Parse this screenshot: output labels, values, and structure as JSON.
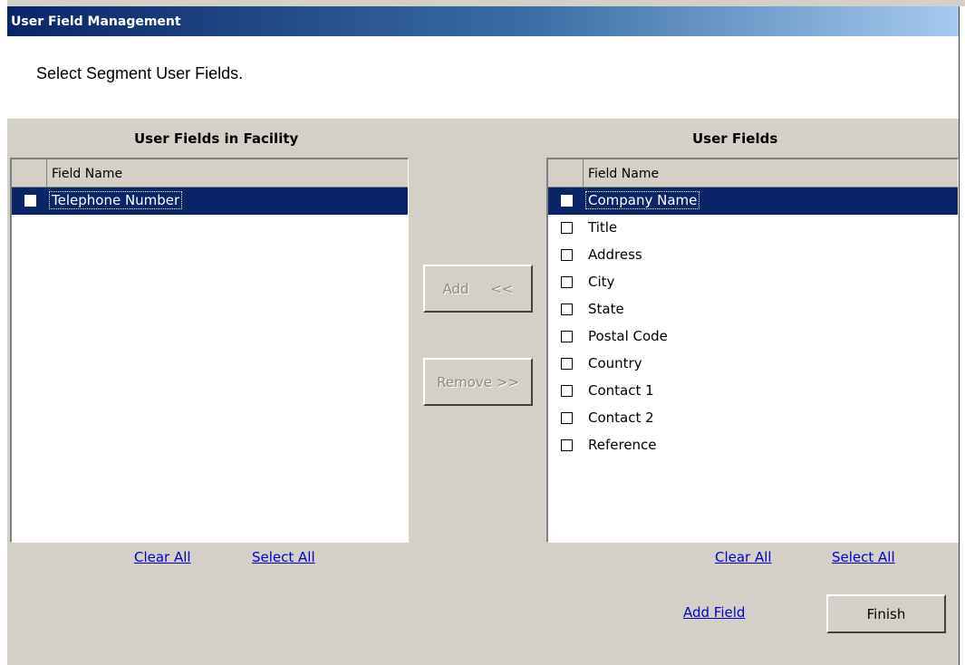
{
  "window": {
    "title": "User Field Management"
  },
  "header": {
    "instruction": "Select Segment User Fields."
  },
  "left_panel": {
    "title": "User Fields in Facility",
    "column_header": "Field Name",
    "rows": [
      {
        "label": "Telephone Number",
        "selected": true
      }
    ],
    "clear_all": "Clear All",
    "select_all": "Select All"
  },
  "right_panel": {
    "title": "User Fields",
    "column_header": "Field Name",
    "rows": [
      {
        "label": "Company Name",
        "selected": true
      },
      {
        "label": "Title",
        "selected": false
      },
      {
        "label": "Address",
        "selected": false
      },
      {
        "label": "City",
        "selected": false
      },
      {
        "label": "State",
        "selected": false
      },
      {
        "label": "Postal Code",
        "selected": false
      },
      {
        "label": "Country",
        "selected": false
      },
      {
        "label": "Contact 1",
        "selected": false
      },
      {
        "label": "Contact 2",
        "selected": false
      },
      {
        "label": "Reference",
        "selected": false
      }
    ],
    "clear_all": "Clear All",
    "select_all": "Select All"
  },
  "middle": {
    "add_label": "Add     <<",
    "remove_label": "Remove >>"
  },
  "footer": {
    "add_field": "Add Field",
    "finish": "Finish"
  }
}
